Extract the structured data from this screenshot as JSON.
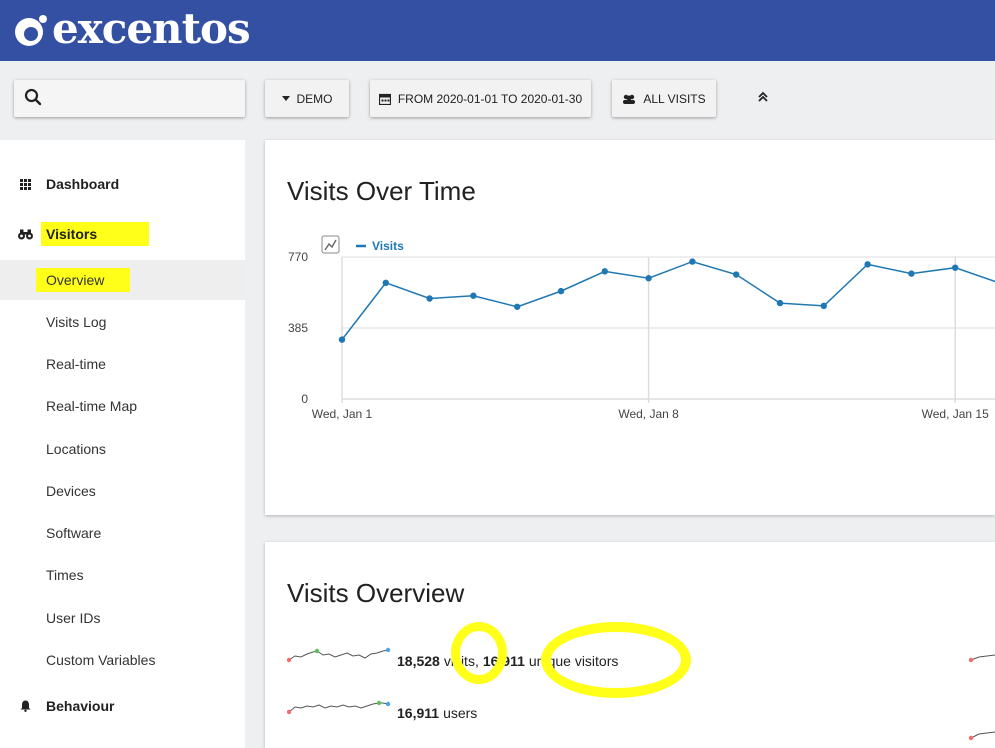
{
  "header": {
    "logo_text": "excentos",
    "brand_color": "#3450a3"
  },
  "toolbar": {
    "search": {
      "value": "",
      "placeholder": ""
    },
    "site_label": "DEMO",
    "date_label": "FROM 2020-01-01 TO 2020-01-30",
    "segment_label": "ALL VISITS"
  },
  "sidebar": {
    "dashboard_label": "Dashboard",
    "visitors_label": "Visitors",
    "items": [
      {
        "label": "Overview",
        "active": true
      },
      {
        "label": "Visits Log"
      },
      {
        "label": "Real-time"
      },
      {
        "label": "Real-time Map"
      },
      {
        "label": "Locations"
      },
      {
        "label": "Devices"
      },
      {
        "label": "Software"
      },
      {
        "label": "Times"
      },
      {
        "label": "User IDs"
      },
      {
        "label": "Custom Variables"
      }
    ],
    "behaviour_label": "Behaviour",
    "highlight_color": "#ffff1a"
  },
  "visits_over_time": {
    "title": "Visits Over Time",
    "chart_data": {
      "type": "line",
      "series": [
        {
          "name": "Visits",
          "color": "#1f78b4",
          "values": [
            322,
            630,
            545,
            560,
            500,
            585,
            692,
            655,
            745,
            675,
            520,
            505,
            730,
            680,
            712,
            630
          ]
        }
      ],
      "x": [
        "2020-01-01",
        "2020-01-02",
        "2020-01-03",
        "2020-01-04",
        "2020-01-05",
        "2020-01-06",
        "2020-01-07",
        "2020-01-08",
        "2020-01-09",
        "2020-01-10",
        "2020-01-11",
        "2020-01-12",
        "2020-01-13",
        "2020-01-14",
        "2020-01-15",
        "2020-01-16"
      ],
      "y_ticks": [
        "770",
        "385",
        "0"
      ],
      "x_ticks": [
        "Wed, Jan 1",
        "Wed, Jan 8",
        "Wed, Jan 15"
      ],
      "ylim": [
        0,
        770
      ],
      "grid": true,
      "legend": "top-left"
    }
  },
  "visits_overview": {
    "title": "Visits Overview",
    "row1": {
      "visits": "18,528",
      "visits_text": "visits,",
      "unique": "16,911",
      "unique_text": "unique visitors"
    },
    "row2": {
      "users": "16,911",
      "users_text": "users"
    }
  }
}
